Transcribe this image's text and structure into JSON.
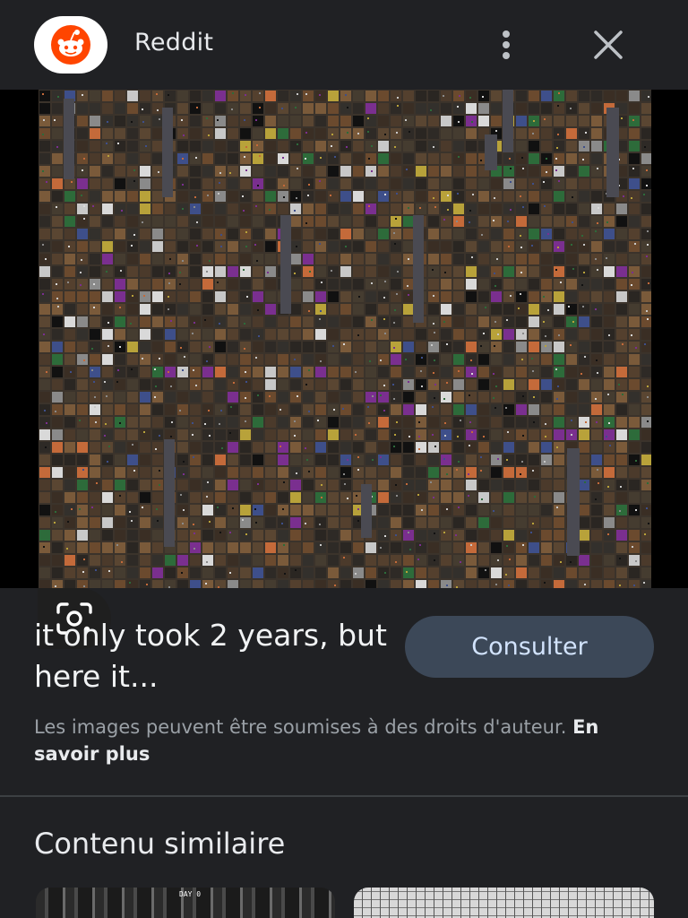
{
  "header": {
    "source_name": "Reddit",
    "logo_icon": "reddit-logo-icon",
    "more_icon": "more-vert-icon",
    "close_icon": "close-icon",
    "logo_color": "#ff4500"
  },
  "image": {
    "lens_icon": "google-lens-icon"
  },
  "result": {
    "title": "it only took 2 years, but here it...",
    "visit_label": "Consulter",
    "copyright_text": "Les images peuvent être soumises à des droits d'auteur.",
    "learn_more_label": "En savoir plus"
  },
  "similar": {
    "heading": "Contenu similaire",
    "thumb_1_caption": "DAY 0"
  },
  "colors": {
    "background": "#202124",
    "button_bg": "#3c4858",
    "button_text": "#d2e3fc"
  }
}
